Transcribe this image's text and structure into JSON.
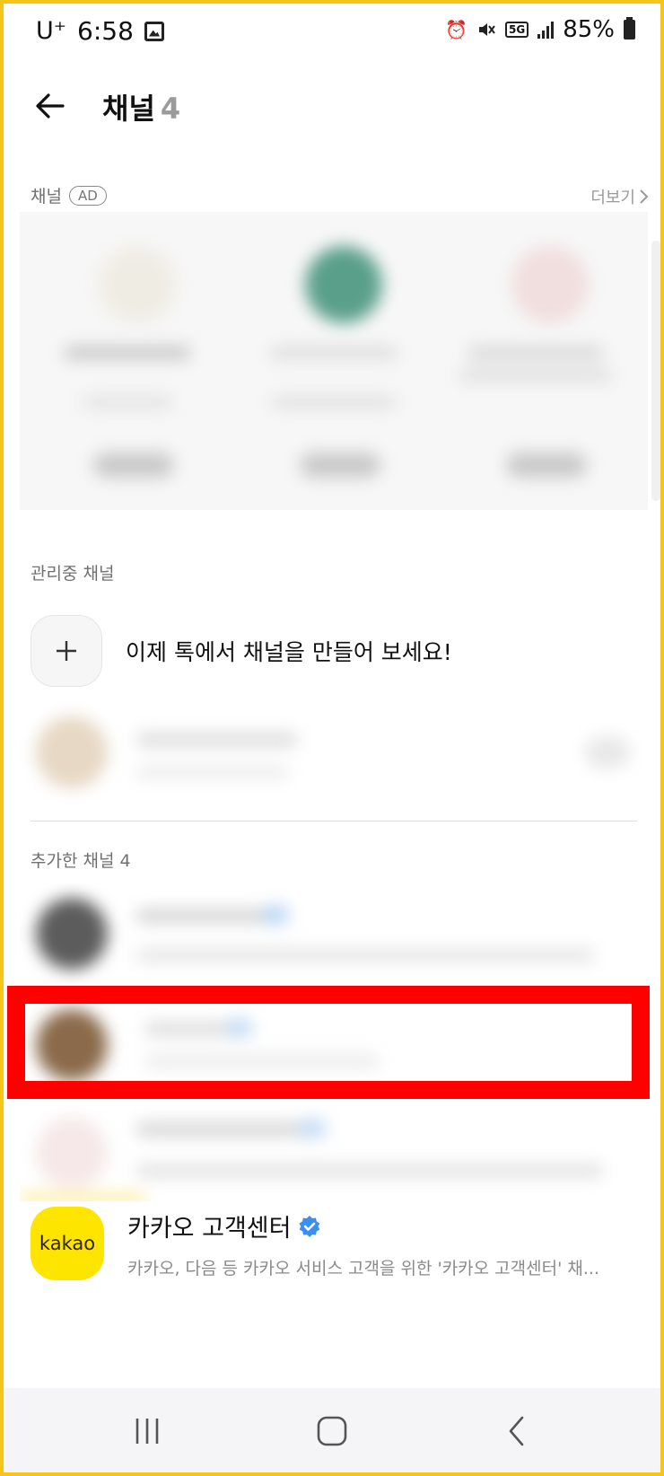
{
  "status_bar": {
    "carrier": "U⁺",
    "time": "6:58",
    "network": "5G",
    "battery": "85%",
    "icons": [
      "gallery-icon",
      "alarm-icon",
      "mute-icon",
      "signal-icon",
      "battery-icon"
    ]
  },
  "header": {
    "title": "채널",
    "count": "4"
  },
  "ad_section": {
    "label": "채널",
    "badge": "AD",
    "more": "더보기"
  },
  "managed_section": {
    "label": "관리중 채널",
    "create_text": "이제 톡에서 채널을 만들어 보세요!"
  },
  "added_section": {
    "label": "추가한 채널 4"
  },
  "kakao_channel": {
    "logo_text": "kakao",
    "name": "카카오 고객센터",
    "description": "카카오, 다음 등 카카오 서비스 고객을 위한 '카카오 고객센터' 채...",
    "logo_color": "#fee500",
    "verified_color": "#3a8ff0"
  },
  "highlight_color": "#ff0000",
  "nav_bar": {
    "icons": [
      "recent-apps-icon",
      "home-icon",
      "back-icon"
    ]
  }
}
